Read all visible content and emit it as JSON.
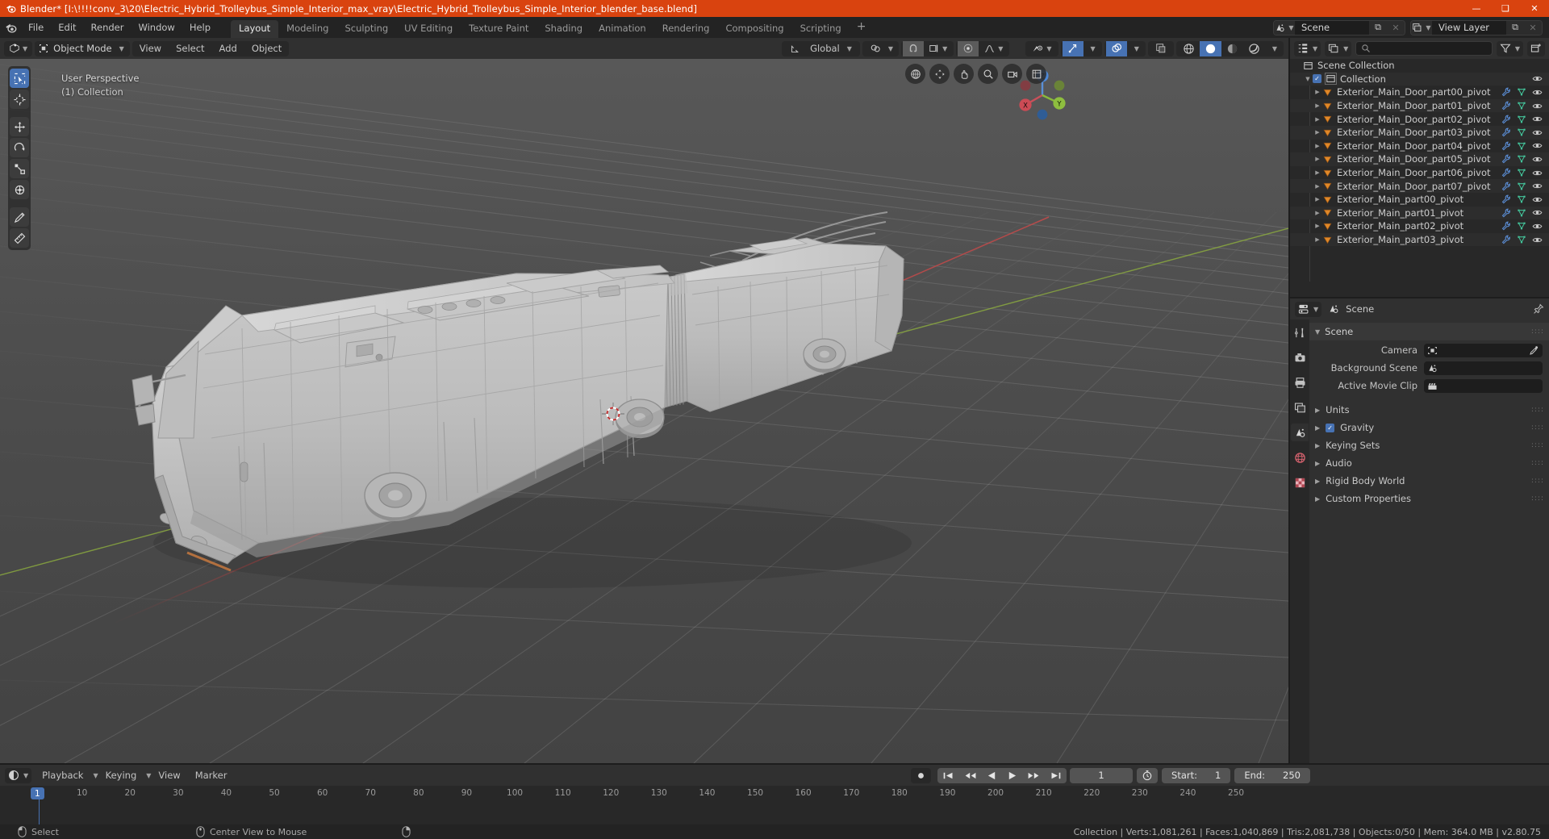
{
  "titlebar": {
    "text": "Blender* [I:\\!!!!conv_3\\20\\Electric_Hybrid_Trolleybus_Simple_Interior_max_vray\\Electric_Hybrid_Trolleybus_Simple_Interior_blender_base.blend]",
    "icon": "blender-logo-icon",
    "accent_color": "#d9430f",
    "minimize": "—",
    "maximize": "❑",
    "close": "✕"
  },
  "topbar": {
    "menus": [
      "File",
      "Edit",
      "Render",
      "Window",
      "Help"
    ],
    "workspaces": [
      {
        "label": "Layout",
        "active": true
      },
      {
        "label": "Modeling",
        "active": false
      },
      {
        "label": "Sculpting",
        "active": false
      },
      {
        "label": "UV Editing",
        "active": false
      },
      {
        "label": "Texture Paint",
        "active": false
      },
      {
        "label": "Shading",
        "active": false
      },
      {
        "label": "Animation",
        "active": false
      },
      {
        "label": "Rendering",
        "active": false
      },
      {
        "label": "Compositing",
        "active": false
      },
      {
        "label": "Scripting",
        "active": false
      }
    ],
    "add_workspace": "+",
    "scene": {
      "name": "Scene",
      "icon": "scene-icon",
      "new_btn": "⧉",
      "unlink_btn": "✕"
    },
    "view_layer": {
      "name": "View Layer",
      "icon": "view-layer-icon",
      "new_btn": "⧉",
      "unlink_btn": "✕"
    }
  },
  "viewport_header": {
    "editor_type_icon": "editor-type-3dview-icon",
    "mode": "Object Mode",
    "mode_icon": "object-mode-icon",
    "menus": [
      "View",
      "Select",
      "Add",
      "Object"
    ],
    "transform_orientation": "Global",
    "transform_orientation_icon": "orientation-gizmo-icon",
    "pivot_icon": "pivot-point-icon",
    "snap_icon": "magnet-icon",
    "snap_target_icon": "snap-increment-icon",
    "proportional_icon": "proportional-edit-icon",
    "falloff_icon": "smooth-falloff-icon",
    "visibility_icon": "show-hide-icon",
    "gizmo_icon": "gizmo-icon",
    "overlays_icon": "overlays-icon",
    "xray_icon": "xray-toggle-icon",
    "shading_modes": [
      "wireframe",
      "solid",
      "material-preview",
      "rendered"
    ],
    "shading_active": "solid"
  },
  "viewport": {
    "perspective_label": "User Perspective",
    "collection_label": "(1) Collection",
    "tools": [
      {
        "name": "select-box-tool",
        "active": true
      },
      {
        "name": "cursor-tool",
        "active": false
      },
      {
        "name": "move-tool",
        "active": false
      },
      {
        "name": "rotate-tool",
        "active": false
      },
      {
        "name": "scale-tool",
        "active": false
      },
      {
        "name": "transform-tool",
        "active": false
      },
      {
        "name": "annotate-tool",
        "active": false
      },
      {
        "name": "measure-tool",
        "active": false
      }
    ],
    "gizmo_axes": {
      "x": "X",
      "y": "Y",
      "z": "Z"
    },
    "nav_buttons": [
      "zoom-camera-icon",
      "move-view-icon",
      "hand-pan-icon",
      "magnify-icon",
      "camera-view-icon",
      "toggle-ortho-icon"
    ]
  },
  "outliner": {
    "display_mode_icon": "outliner-display-mode-icon",
    "filter_id_icon": "outliner-filter-id-icon",
    "search_placeholder": "",
    "filter_icon": "funnel-icon",
    "new_collection_icon": "new-collection-icon",
    "rows": [
      {
        "label": "Scene Collection",
        "indent": 0,
        "icon": "scene-collection-icon",
        "disclosure": "",
        "checkbox": false,
        "modifier": false,
        "mesh": false,
        "eye": false
      },
      {
        "label": "Collection",
        "indent": 1,
        "icon": "collection-icon",
        "disclosure": "▼",
        "checkbox": true,
        "modifier": false,
        "mesh": false,
        "eye": true
      },
      {
        "label": "Exterior_Main_Door_part00_pivot",
        "indent": 2,
        "icon": "empty-pivot-icon",
        "disclosure": "▶",
        "checkbox": false,
        "modifier": true,
        "mesh": true,
        "eye": true
      },
      {
        "label": "Exterior_Main_Door_part01_pivot",
        "indent": 2,
        "icon": "empty-pivot-icon",
        "disclosure": "▶",
        "checkbox": false,
        "modifier": true,
        "mesh": true,
        "eye": true
      },
      {
        "label": "Exterior_Main_Door_part02_pivot",
        "indent": 2,
        "icon": "empty-pivot-icon",
        "disclosure": "▶",
        "checkbox": false,
        "modifier": true,
        "mesh": true,
        "eye": true
      },
      {
        "label": "Exterior_Main_Door_part03_pivot",
        "indent": 2,
        "icon": "empty-pivot-icon",
        "disclosure": "▶",
        "checkbox": false,
        "modifier": true,
        "mesh": true,
        "eye": true
      },
      {
        "label": "Exterior_Main_Door_part04_pivot",
        "indent": 2,
        "icon": "empty-pivot-icon",
        "disclosure": "▶",
        "checkbox": false,
        "modifier": true,
        "mesh": true,
        "eye": true
      },
      {
        "label": "Exterior_Main_Door_part05_pivot",
        "indent": 2,
        "icon": "empty-pivot-icon",
        "disclosure": "▶",
        "checkbox": false,
        "modifier": true,
        "mesh": true,
        "eye": true
      },
      {
        "label": "Exterior_Main_Door_part06_pivot",
        "indent": 2,
        "icon": "empty-pivot-icon",
        "disclosure": "▶",
        "checkbox": false,
        "modifier": true,
        "mesh": true,
        "eye": true
      },
      {
        "label": "Exterior_Main_Door_part07_pivot",
        "indent": 2,
        "icon": "empty-pivot-icon",
        "disclosure": "▶",
        "checkbox": false,
        "modifier": true,
        "mesh": true,
        "eye": true
      },
      {
        "label": "Exterior_Main_part00_pivot",
        "indent": 2,
        "icon": "empty-pivot-icon",
        "disclosure": "▶",
        "checkbox": false,
        "modifier": true,
        "mesh": true,
        "eye": true
      },
      {
        "label": "Exterior_Main_part01_pivot",
        "indent": 2,
        "icon": "empty-pivot-icon",
        "disclosure": "▶",
        "checkbox": false,
        "modifier": true,
        "mesh": true,
        "eye": true
      },
      {
        "label": "Exterior_Main_part02_pivot",
        "indent": 2,
        "icon": "empty-pivot-icon",
        "disclosure": "▶",
        "checkbox": false,
        "modifier": true,
        "mesh": true,
        "eye": true
      },
      {
        "label": "Exterior_Main_part03_pivot",
        "indent": 2,
        "icon": "empty-pivot-icon",
        "disclosure": "▶",
        "checkbox": false,
        "modifier": true,
        "mesh": true,
        "eye": true
      }
    ]
  },
  "properties": {
    "editor_icon": "properties-editor-icon",
    "breadcrumb_icon": "scene-icon",
    "breadcrumb": "Scene",
    "pin_icon": "pin-icon",
    "tabs": [
      {
        "name": "tool-tab",
        "icon": "tool-icon",
        "active": false
      },
      {
        "name": "render-tab",
        "icon": "render-camera-icon",
        "active": false
      },
      {
        "name": "output-tab",
        "icon": "printer-icon",
        "active": false
      },
      {
        "name": "view-layer-tab",
        "icon": "images-icon",
        "active": false
      },
      {
        "name": "scene-tab",
        "icon": "scene-cone-icon",
        "active": true
      },
      {
        "name": "world-tab",
        "icon": "world-globe-icon",
        "active": false
      },
      {
        "name": "texture-tab",
        "icon": "checker-texture-icon",
        "active": false
      }
    ],
    "panel_title": "Scene",
    "panel_expanded": true,
    "fields": [
      {
        "label": "Camera",
        "value": "",
        "icon": "camera-data-icon",
        "has_eyedropper": true
      },
      {
        "label": "Background Scene",
        "value": "",
        "icon": "scene-icon",
        "has_eyedropper": false
      },
      {
        "label": "Active Movie Clip",
        "value": "",
        "icon": "movie-clip-icon",
        "has_eyedropper": false
      }
    ],
    "sections": [
      {
        "label": "Units",
        "expanded": false,
        "checkbox": null
      },
      {
        "label": "Gravity",
        "expanded": false,
        "checkbox": true
      },
      {
        "label": "Keying Sets",
        "expanded": false,
        "checkbox": null
      },
      {
        "label": "Audio",
        "expanded": false,
        "checkbox": null
      },
      {
        "label": "Rigid Body World",
        "expanded": false,
        "checkbox": null
      },
      {
        "label": "Custom Properties",
        "expanded": false,
        "checkbox": null
      }
    ]
  },
  "timeline": {
    "editor_icon": "timeline-editor-icon",
    "menus": [
      "Playback",
      "Keying",
      "View",
      "Marker"
    ],
    "transport": [
      "record-icon",
      "jump-start-icon",
      "prev-keyframe-icon",
      "play-reverse-icon",
      "play-icon",
      "next-keyframe-icon",
      "jump-end-icon"
    ],
    "current_frame": "1",
    "use_preview_icon": "stopwatch-icon",
    "start_label": "Start:",
    "start_value": "1",
    "end_label": "End:",
    "end_value": "250",
    "ticks": [
      10,
      20,
      30,
      40,
      50,
      60,
      70,
      80,
      90,
      100,
      110,
      120,
      130,
      140,
      150,
      160,
      170,
      180,
      190,
      200,
      210,
      220,
      230,
      240,
      250
    ],
    "playhead_label": "1"
  },
  "statusbar": {
    "left_mouse_icon": "mouse-left-icon",
    "left_action": "Select",
    "middle_mouse_icon": "mouse-middle-icon",
    "middle_action": "Center View to Mouse",
    "right_mouse_icon": "mouse-right-icon",
    "right_action": "",
    "stats": "Collection | Verts:1,081,261 | Faces:1,040,869 | Tris:2,081,738 | Objects:0/50 | Mem: 364.0 MB | v2.80.75"
  },
  "colors": {
    "accent_blue": "#4772b3",
    "title_orange": "#d9430f",
    "empty_orange": "#e08828",
    "mesh_green": "#43c49a",
    "modifier_blue": "#5b8ed6",
    "header_gray": "#303030",
    "panel_gray": "#282828"
  }
}
